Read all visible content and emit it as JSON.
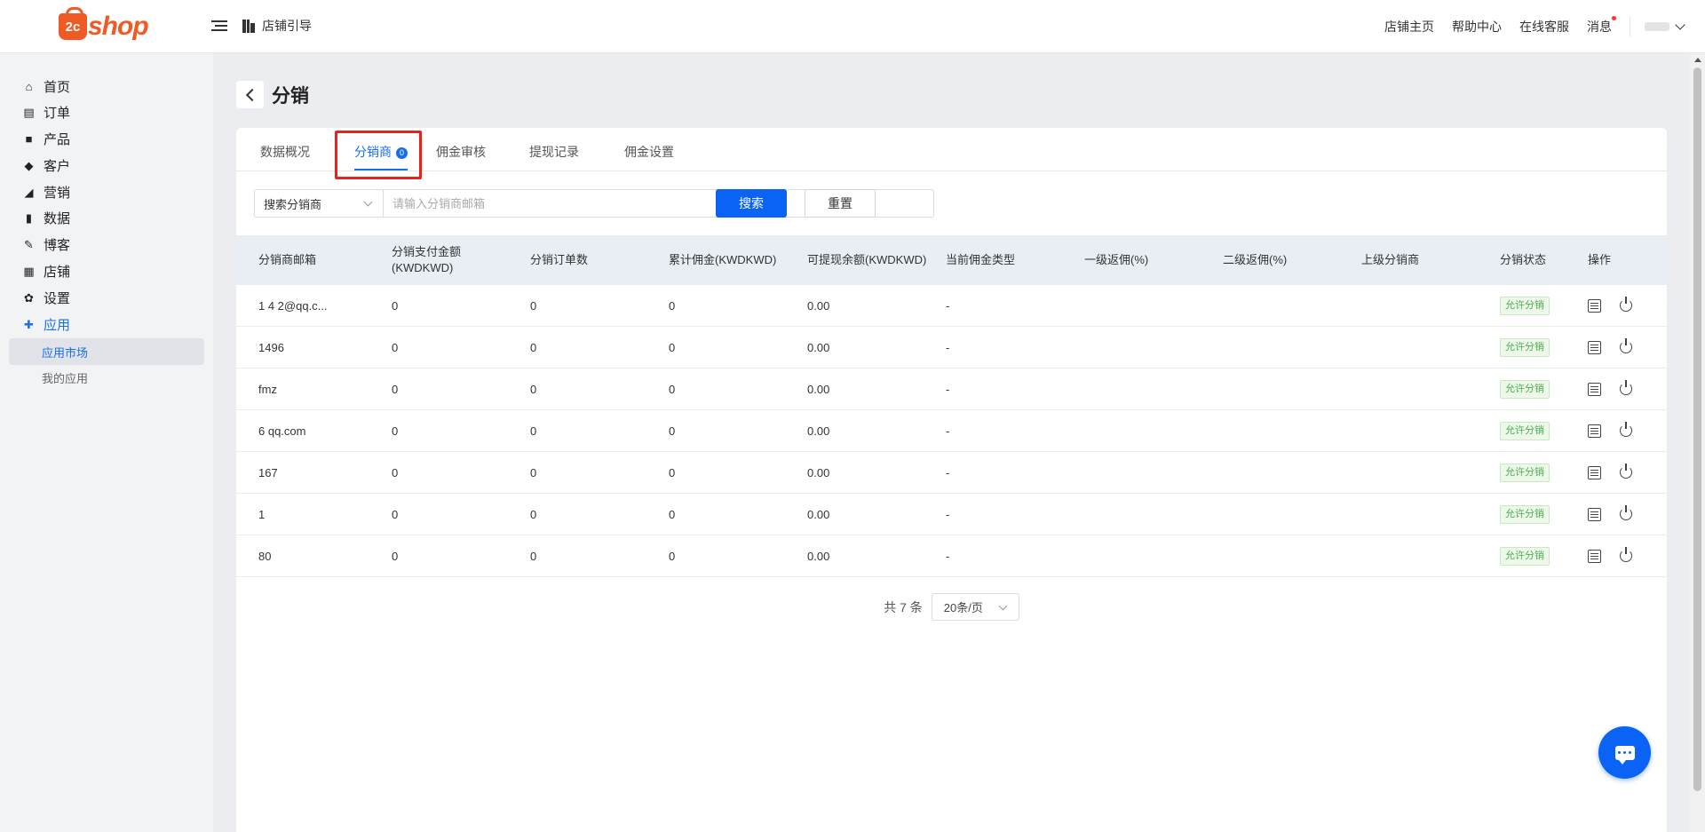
{
  "header": {
    "logo_prefix": "2c",
    "logo_text": "shop",
    "guide_label": "店铺引导",
    "nav": [
      "店铺主页",
      "帮助中心",
      "在线客服",
      "消息"
    ]
  },
  "sidebar": {
    "items": [
      {
        "label": "首页",
        "icon": "home-icon",
        "glyph": "⌂"
      },
      {
        "label": "订单",
        "icon": "order-icon",
        "glyph": "▤"
      },
      {
        "label": "产品",
        "icon": "bag-icon",
        "glyph": "■"
      },
      {
        "label": "客户",
        "icon": "diamond-icon",
        "glyph": "◆"
      },
      {
        "label": "营销",
        "icon": "tag-icon",
        "glyph": "◢"
      },
      {
        "label": "数据",
        "icon": "chart-icon",
        "glyph": "▮"
      },
      {
        "label": "博客",
        "icon": "edit-icon",
        "glyph": "✎"
      },
      {
        "label": "店铺",
        "icon": "store-icon",
        "glyph": "▦"
      },
      {
        "label": "设置",
        "icon": "gear-icon",
        "glyph": "✿"
      },
      {
        "label": "应用",
        "icon": "puzzle-icon",
        "glyph": "✚"
      }
    ],
    "sub_items": [
      "应用市场",
      "我的应用"
    ]
  },
  "page": {
    "title": "分销"
  },
  "tabs": [
    {
      "label": "数据概况"
    },
    {
      "label": "分销商",
      "badge": "0"
    },
    {
      "label": "佣金审核"
    },
    {
      "label": "提现记录"
    },
    {
      "label": "佣金设置"
    }
  ],
  "filter": {
    "select_value": "搜索分销商",
    "search_placeholder": "请输入分销商邮箱",
    "search_button": "搜索",
    "reset_button": "重置"
  },
  "table": {
    "columns": [
      "分销商邮箱",
      "分销支付金额(KWDKWD)",
      "分销订单数",
      "累计佣金(KWDKWD)",
      "可提现余额(KWDKWD)",
      "当前佣金类型",
      "一级返佣(%)",
      "二级返佣(%)",
      "上级分销商",
      "分销状态",
      "操作"
    ],
    "rows": [
      {
        "email": "1 4 2@qq.c...",
        "pay": "0",
        "orders": "0",
        "commission": "0",
        "balance": "0.00",
        "type": "-",
        "status": "允许分销"
      },
      {
        "email": "1496",
        "pay": "0",
        "orders": "0",
        "commission": "0",
        "balance": "0.00",
        "type": "-",
        "status": "允许分销"
      },
      {
        "email": "fmz",
        "pay": "0",
        "orders": "0",
        "commission": "0",
        "balance": "0.00",
        "type": "-",
        "status": "允许分销"
      },
      {
        "email": "6 qq.com",
        "pay": "0",
        "orders": "0",
        "commission": "0",
        "balance": "0.00",
        "type": "-",
        "status": "允许分销"
      },
      {
        "email": "167",
        "pay": "0",
        "orders": "0",
        "commission": "0",
        "balance": "0.00",
        "type": "-",
        "status": "允许分销"
      },
      {
        "email": "1",
        "pay": "0",
        "orders": "0",
        "commission": "0",
        "balance": "0.00",
        "type": "-",
        "status": "允许分销"
      },
      {
        "email": "80",
        "pay": "0",
        "orders": "0",
        "commission": "0",
        "balance": "0.00",
        "type": "-",
        "status": "允许分销"
      }
    ]
  },
  "pagination": {
    "total_text": "共 7 条",
    "page_size": "20条/页"
  },
  "colors": {
    "accent": "#0b63f5",
    "logo": "#f05a24",
    "highlight": "#e8211d",
    "status_green": "#4caf50"
  }
}
